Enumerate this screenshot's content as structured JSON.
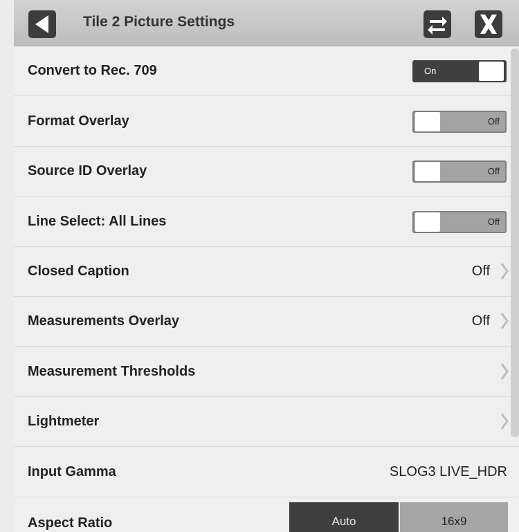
{
  "header": {
    "title": "Tile 2 Picture Settings",
    "back_icon": "back-triangle-icon",
    "swap_icon": "swap-arrows-icon",
    "close_icon": "close-x-icon"
  },
  "toggles": [
    {
      "label": "Convert to Rec. 709",
      "state": "On"
    },
    {
      "label": "Format Overlay",
      "state": "Off"
    },
    {
      "label": "Source ID Overlay",
      "state": "Off"
    },
    {
      "label": "Line Select: All Lines",
      "state": "Off"
    }
  ],
  "menu_rows": [
    {
      "label": "Closed Caption",
      "value": "Off"
    },
    {
      "label": "Measurements Overlay",
      "value": "Off"
    },
    {
      "label": "Measurement Thresholds",
      "value": ""
    },
    {
      "label": "Lightmeter",
      "value": ""
    }
  ],
  "input_gamma": {
    "label": "Input Gamma",
    "value": "SLOG3 LIVE_HDR"
  },
  "aspect_ratio": {
    "label": "Aspect Ratio",
    "options": [
      "Auto",
      "16x9"
    ],
    "selected": "Auto"
  },
  "colors": {
    "header_bg": "#c6c6c6",
    "button_bg": "#3c3c3c",
    "toggle_on": "#404040",
    "toggle_off": "#a4a4a4"
  }
}
